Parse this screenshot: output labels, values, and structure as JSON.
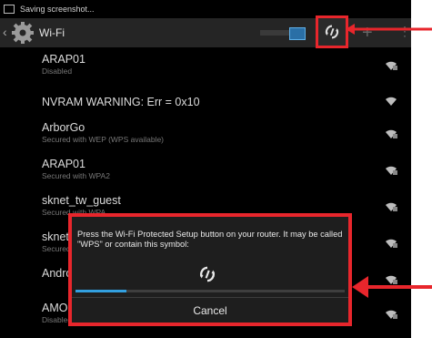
{
  "status_bar": {
    "text": "Saving screenshot..."
  },
  "action_bar": {
    "title": "Wi-Fi",
    "toggle_state": "on",
    "plus_icon": "+",
    "overflow_icon": "⋮"
  },
  "networks": [
    {
      "name": "ARAP01",
      "status": "Disabled"
    },
    {
      "name": "NVRAM WARNING: Err = 0x10",
      "status": ""
    },
    {
      "name": "ArborGo",
      "status": "Secured with WEP (WPS available)"
    },
    {
      "name": "ARAP01",
      "status": "Secured with WPA2"
    },
    {
      "name": "sknet_tw_guest",
      "status": "Secured with WPA"
    },
    {
      "name": "sknet",
      "status": "Secured"
    },
    {
      "name": "Andro",
      "status": ""
    },
    {
      "name": "AMO",
      "status": "Disabled"
    }
  ],
  "dialog": {
    "message": "Press the Wi-Fi Protected Setup button on your router. It may be called \"WPS\" or contain this symbol:",
    "progress": 0.19,
    "cancel_label": "Cancel"
  },
  "colors": {
    "highlight": "#e8262c",
    "accent": "#33a0e0"
  }
}
